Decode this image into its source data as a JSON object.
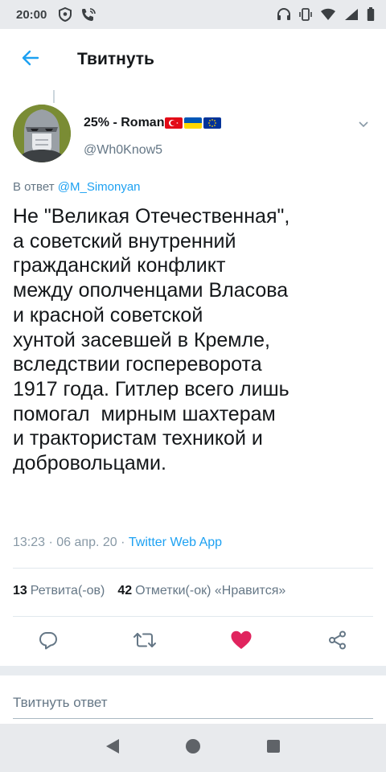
{
  "status_bar": {
    "time": "20:00"
  },
  "header": {
    "title": "Твитнуть"
  },
  "tweet": {
    "display_name": "25% - Roman",
    "username": "@Wh0Know5",
    "reply_prefix": "В ответ",
    "reply_to": "@M_Simonyan",
    "text": "Не \"Великая Отечественная\",\nа советский внутренний\nгражданский конфликт\nмежду ополченцами Власова\nи красной советской\nхунтой засевшей в Кремле,\nвследствии госпереворота\n1917 года. Гитлер всего лишь\nпомогал  мирным шахтерам\nи трактористам техникой и\nдобровольцами.",
    "time": "13:23 · 06 апр. 20 · ",
    "source": "Twitter Web App"
  },
  "stats": {
    "retweets_count": "13",
    "retweets_label": "Ретвита(-ов)",
    "likes_count": "42",
    "likes_label": "Отметки(-ок) «Нравится»"
  },
  "reply": {
    "placeholder": "Твитнуть ответ"
  },
  "colors": {
    "accent": "#1da1f2",
    "like": "#e0245e",
    "muted": "#657786"
  },
  "icons": [
    "back-arrow-icon",
    "reply-icon",
    "retweet-icon",
    "heart-icon",
    "share-icon",
    "caret-down-icon"
  ]
}
